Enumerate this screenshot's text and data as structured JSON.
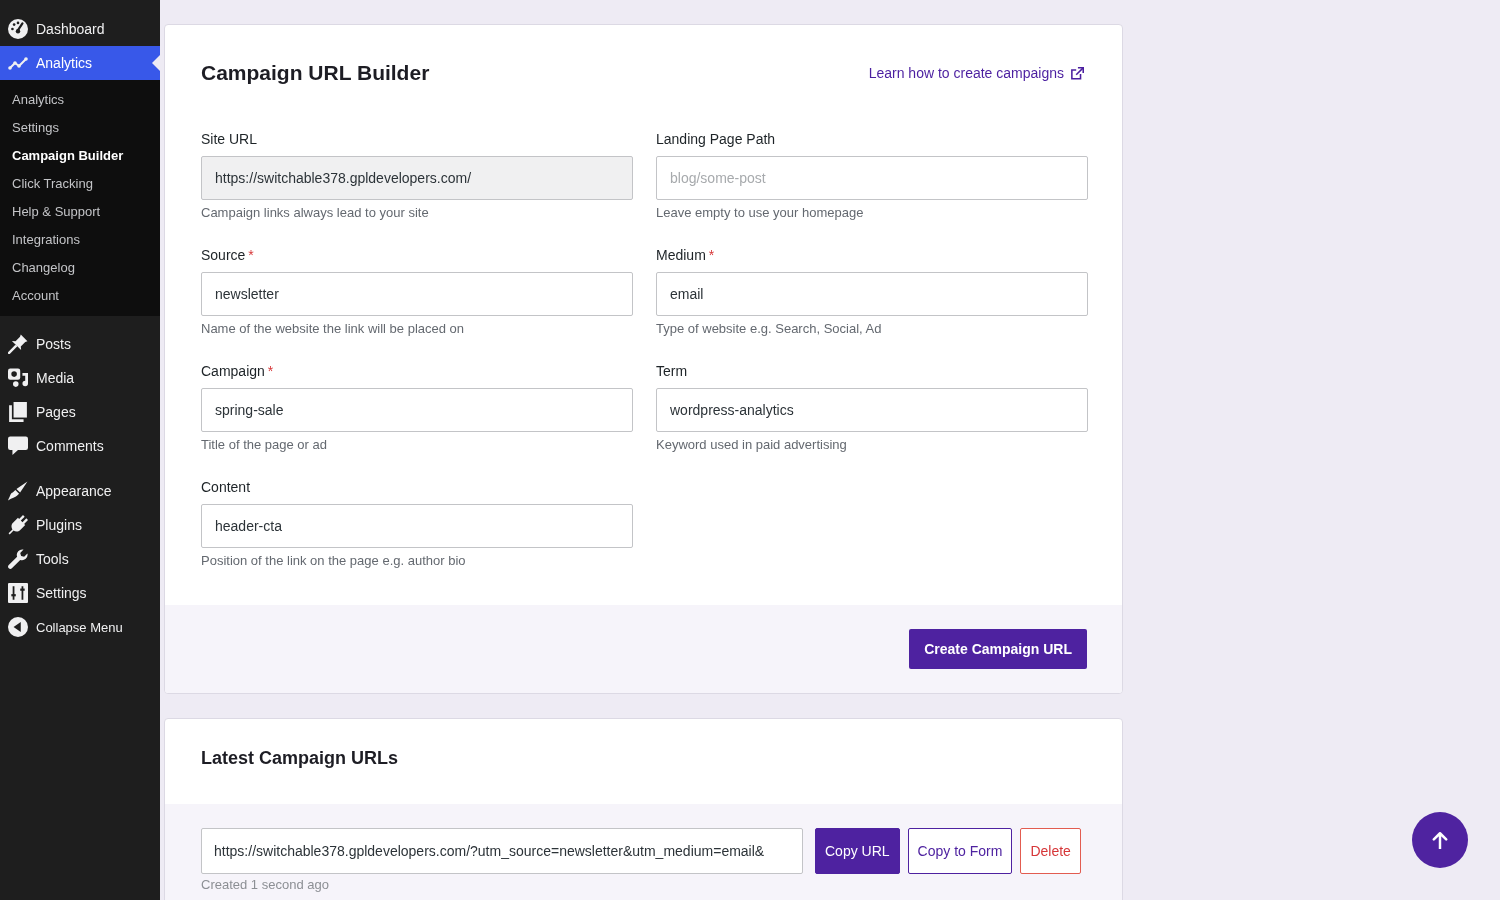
{
  "sidebar": {
    "groups": [
      {
        "items": [
          {
            "label": "Dashboard",
            "selected": false
          },
          {
            "label": "Analytics",
            "selected": true,
            "children": [
              {
                "label": "Analytics",
                "selected": false
              },
              {
                "label": "Settings",
                "selected": false
              },
              {
                "label": "Campaign Builder",
                "selected": true
              },
              {
                "label": "Click Tracking",
                "selected": false
              },
              {
                "label": "Help & Support",
                "selected": false
              },
              {
                "label": "Integrations",
                "selected": false
              },
              {
                "label": "Changelog",
                "selected": false
              },
              {
                "label": "Account",
                "selected": false
              }
            ]
          }
        ]
      },
      {
        "items": [
          {
            "label": "Posts",
            "selected": false
          },
          {
            "label": "Media",
            "selected": false
          },
          {
            "label": "Pages",
            "selected": false
          },
          {
            "label": "Comments",
            "selected": false
          }
        ]
      },
      {
        "items": [
          {
            "label": "Appearance",
            "selected": false
          },
          {
            "label": "Plugins",
            "selected": false
          },
          {
            "label": "Tools",
            "selected": false
          },
          {
            "label": "Settings",
            "selected": false
          }
        ]
      }
    ],
    "collapse_button": {
      "label": "Collapse Menu"
    }
  },
  "builder": {
    "title": "Campaign URL Builder",
    "help_link": {
      "label": "Learn how to create campaigns"
    },
    "fields": [
      {
        "label": "Site URL",
        "value": "https://switchable378.gpldevelopers.com/",
        "disabled": true,
        "help": "Campaign links always lead to your site"
      },
      {
        "label": "Landing Page Path",
        "placeholder": "blog/some-post",
        "disabled": false,
        "help": "Leave empty to use your homepage"
      },
      {
        "label": "Source",
        "required_mark": "*",
        "value": "newsletter",
        "disabled": false,
        "help": "Name of the website the link will be placed on"
      },
      {
        "label": "Medium",
        "required_mark": "*",
        "value": "email",
        "disabled": false,
        "help": "Type of website e.g. Search, Social, Ad"
      },
      {
        "label": "Campaign",
        "required_mark": "*",
        "value": "spring-sale",
        "disabled": false,
        "help": "Title of the page or ad"
      },
      {
        "label": "Term",
        "value": "wordpress-analytics",
        "disabled": false,
        "help": "Keyword used in paid advertising"
      },
      {
        "label": "Content",
        "value": "header-cta",
        "disabled": false,
        "help": "Position of the link on the page e.g. author bio"
      }
    ],
    "submit_button": {
      "label": "Create Campaign URL"
    }
  },
  "latest": {
    "title": "Latest Campaign URLs",
    "entries": [
      {
        "url": "https://switchable378.gpldevelopers.com/?utm_source=newsletter&utm_medium=email&",
        "created": "Created 1 second ago",
        "actions": [
          {
            "label": "Copy URL",
            "kind": "copy"
          },
          {
            "label": "Copy to Form",
            "kind": "copy_to_form"
          },
          {
            "label": "Delete",
            "kind": "delete"
          }
        ]
      }
    ]
  }
}
